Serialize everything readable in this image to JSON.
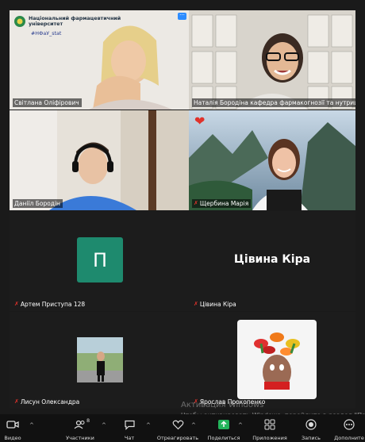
{
  "tiles": {
    "svetlana": {
      "name": "Світлана Оліфірович",
      "logo_line1": "Національний фармацевтичний",
      "logo_line2": "університет",
      "hashtag": "#НФаУ_stat"
    },
    "natalia": {
      "name": "Наталія Бородіна кафедра фармакогнозії та нутриціології"
    },
    "daniil": {
      "name": "Даніїл Бородін"
    },
    "maria": {
      "name": "Щербина Марія"
    },
    "artem": {
      "name": "Артем Приступа 128",
      "avatar_letter": "П"
    },
    "tsivina": {
      "name": "Цівина Кіра",
      "display_name": "Цівина Кіра"
    },
    "lysun": {
      "name": "Лисун Олександра"
    },
    "yaroslav": {
      "name": "Ярослав Прокопенко"
    }
  },
  "watermark": {
    "title": "Активация Windows",
    "subtitle": "Чтобы активировать Windows, перейдите в раздел \"Па"
  },
  "toolbar": {
    "video": "Видео",
    "participants": "Участники",
    "participants_count": "8",
    "chat": "Чат",
    "react": "Отреагировать",
    "share": "Поделиться",
    "apps": "Приложения",
    "record": "Запись",
    "more": "Дополните"
  },
  "colors": {
    "active_border": "#35c86a",
    "avatar_bg": "#1e8a6e",
    "share_green": "#23b45b",
    "muted_red": "#e0322b"
  }
}
